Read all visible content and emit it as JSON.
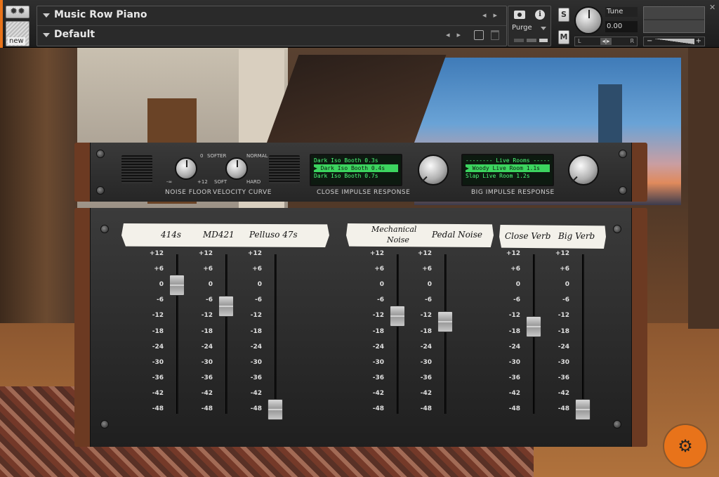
{
  "header": {
    "instrument_name": "Music Row Piano",
    "preset_name": "Default",
    "new_label": "new",
    "purge_label": "Purge",
    "solo_label": "S",
    "mute_label": "M",
    "tune_label": "Tune",
    "tune_value": "0.00",
    "pan_left": "L",
    "pan_right": "R",
    "pan_center": "◂|▸",
    "vol_minus": "−",
    "vol_plus": "+",
    "close_label": "✕",
    "icons": [
      "gear-icon",
      "camera-icon",
      "info-icon",
      "save-icon",
      "trash-icon"
    ]
  },
  "rack": {
    "noise_floor_label": "NOISE FLOOR",
    "velocity_curve_label": "VELOCITY CURVE",
    "knob_marks": {
      "zero": "0",
      "softer": "SOFTER",
      "normal": "NORMAL",
      "minus_inf": "-∞",
      "plus12": "+12",
      "soft": "SOFT",
      "hard": "HARD"
    },
    "close_ir_label": "CLOSE IMPULSE RESPONSE",
    "big_ir_label": "BIG IMPULSE RESPONSE",
    "close_ir_items": [
      "Dark Iso Booth 0.3s",
      "▶ Dark Iso Booth 0.4s",
      "Dark Iso Booth 0.7s"
    ],
    "big_ir_items": [
      "-------- Live Rooms --------",
      "▶ Woody Live Room 1.1s",
      "Slap Live Room 1.2s"
    ]
  },
  "mixer": {
    "tape_labels": {
      "ch1": "414s",
      "ch2": "MD421",
      "ch3": "Pelluso 47s",
      "ch4a": "Mechanical",
      "ch4b": "Noise",
      "ch5": "Pedal Noise",
      "ch6": "Close Verb",
      "ch7": "Big Verb"
    },
    "scale": [
      "+12",
      "+6",
      "0",
      "-6",
      "-12",
      "-18",
      "-24",
      "-30",
      "-36",
      "-42",
      "-48"
    ],
    "fader_levels_db": [
      0,
      -8,
      -48,
      -12,
      -14,
      -16,
      -48
    ]
  },
  "colors": {
    "accent": "#e8731a",
    "lcd_green": "#4dff7a"
  }
}
